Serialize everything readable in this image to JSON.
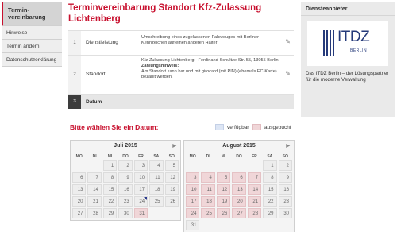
{
  "sidebar": {
    "items": [
      {
        "label": "Termin-\nvereinbarung",
        "active": true
      },
      {
        "label": "Hinweise"
      },
      {
        "label": "Termin ändern"
      },
      {
        "label": "Datenschutzerklärung"
      }
    ]
  },
  "page": {
    "title": "Terminvereinbarung Standort Kfz-Zulassung Lichtenberg"
  },
  "steps": [
    {
      "num": "1",
      "label": "Dienstleistung",
      "content": "Umschreibung eines zugelassenen Fahrzeuges mit Berliner Kennzeichen auf einen anderen Halter",
      "edit_icon": "pencil-icon"
    },
    {
      "num": "2",
      "label": "Standort",
      "content_line1": "Kfz-Zulassung Lichtenberg - Ferdinand-Schultze-Str. 55, 13055 Berlin",
      "content_bold": "Zahlungshinweis:",
      "content_line2": "Am Standort kann bar und mit girocard (mit PIN) (ehemals EC-Karte) bezahlt werden.",
      "edit_icon": "pencil-icon"
    },
    {
      "num": "3",
      "label": "Datum"
    }
  ],
  "date_picker": {
    "title": "Bitte wählen Sie ein Datum:",
    "legend": [
      {
        "label": "verfügbar",
        "color": "#dde6f5"
      },
      {
        "label": "ausgebucht",
        "color": "#f0d6d8"
      }
    ],
    "weekdays": [
      "MO",
      "DI",
      "MI",
      "DO",
      "FR",
      "SA",
      "SO"
    ],
    "months": [
      {
        "title": "Juli 2015",
        "prev": "",
        "next": "▶",
        "weeks": [
          [
            "",
            "",
            "1",
            "2",
            "3",
            "4",
            "5"
          ],
          [
            "6",
            "7",
            "8",
            "9",
            "10",
            "11",
            "12"
          ],
          [
            "13",
            "14",
            "15",
            "16",
            "17",
            "18",
            "19"
          ],
          [
            "20",
            "21",
            "22",
            "23",
            "24",
            "25",
            "26"
          ],
          [
            "27",
            "28",
            "29",
            "30",
            "31",
            "",
            ""
          ]
        ],
        "booked": [
          "31"
        ],
        "selected": "24"
      },
      {
        "title": "August 2015",
        "prev": "",
        "next": "▶",
        "weeks": [
          [
            "",
            "",
            "",
            "",
            "",
            "1",
            "2"
          ],
          [
            "3",
            "4",
            "5",
            "6",
            "7",
            "8",
            "9"
          ],
          [
            "10",
            "11",
            "12",
            "13",
            "14",
            "15",
            "16"
          ],
          [
            "17",
            "18",
            "19",
            "20",
            "21",
            "22",
            "23"
          ],
          [
            "24",
            "25",
            "26",
            "27",
            "28",
            "29",
            "30"
          ],
          [
            "31",
            "",
            "",
            "",
            "",
            "",
            ""
          ]
        ],
        "booked": [
          "3",
          "4",
          "5",
          "6",
          "7",
          "10",
          "11",
          "12",
          "13",
          "14",
          "17",
          "18",
          "19",
          "20",
          "21",
          "24",
          "25",
          "26",
          "27",
          "28"
        ]
      }
    ]
  },
  "provider": {
    "heading": "Diensteanbieter",
    "logo_text": "ITDZ",
    "logo_sub": "BERLIN",
    "description": "Das ITDZ Berlin – der Lösungspartner für die moderne Verwaltung"
  },
  "colors": {
    "accent": "#c8102e",
    "logo": "#253a7a"
  }
}
